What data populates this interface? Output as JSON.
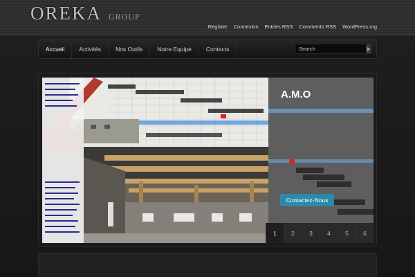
{
  "brand": {
    "logo_mark": "OREKA",
    "logo_sub": "GROUP"
  },
  "top_links": [
    "Register",
    "Connexion",
    "Entries RSS",
    "Comments RSS",
    "WordPress.org"
  ],
  "nav": {
    "items": [
      "Accueil",
      "Activités",
      "Nos Outils",
      "Notre Equipe",
      "Contacts"
    ],
    "active_index": 0
  },
  "search": {
    "placeholder": "Search"
  },
  "slide": {
    "title": "A.M.O",
    "button_label": "Contactez-Nous"
  },
  "pager": {
    "items": [
      "1",
      "2",
      "3",
      "4",
      "5",
      "6"
    ],
    "active_index": 0
  },
  "colors": {
    "accent": "#2c8aa8",
    "background": "#141414"
  },
  "icons": {
    "search_button": "arrow-right-icon"
  }
}
